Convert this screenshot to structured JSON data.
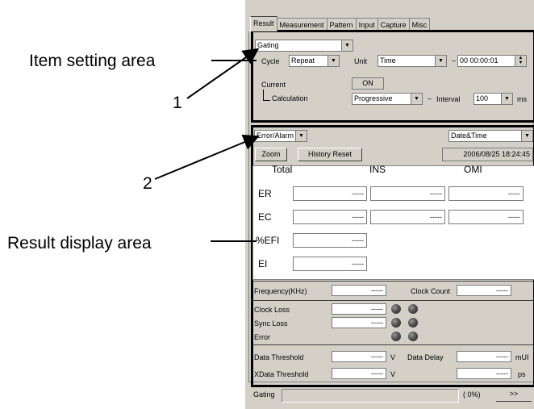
{
  "callouts": {
    "item_setting_area": "Item setting area",
    "result_display_area": "Result display area",
    "num_1": "1",
    "num_2": "2"
  },
  "tabs": [
    "Result",
    "Measurement",
    "Pattern",
    "Input",
    "Capture",
    "Misc"
  ],
  "item_setting": {
    "mode_select": "Gating",
    "cycle_label": "Cycle",
    "cycle_value": "Repeat",
    "unit_label": "Unit",
    "unit_value": "Time",
    "dash1": "–",
    "time_value": "00 00:00:01",
    "current_label": "Current",
    "current_value": "ON",
    "calculation_label": "Calculation",
    "calculation_value": "Progressive",
    "dash2": "–",
    "interval_label": "Interval",
    "interval_value": "100",
    "interval_unit": "ms"
  },
  "result_display": {
    "view_select": "Error/Alarm",
    "datetime_select": "Date&Time",
    "zoom_button": "Zoom",
    "history_reset_button": "History Reset",
    "datetime_value": "2006/08/25 18:24:45",
    "col_headers": [
      "Total",
      "INS",
      "OMI"
    ],
    "rows": [
      {
        "label": "ER",
        "values": [
          "-----",
          "-----",
          "-----"
        ]
      },
      {
        "label": "EC",
        "values": [
          "-----",
          "-----",
          "-----"
        ]
      },
      {
        "label": "%EFI",
        "values": [
          "-----"
        ]
      },
      {
        "label": "EI",
        "values": [
          "-----"
        ]
      }
    ],
    "frequency_label": "Frequency(KHz)",
    "frequency_value": "-----",
    "clock_count_label": "Clock Count",
    "clock_count_value": "-----",
    "clock_loss_label": "Clock Loss",
    "clock_loss_value": "-----",
    "sync_loss_label": "Sync Loss",
    "sync_loss_value": "-----",
    "error_label": "Error",
    "data_threshold_label": "Data Threshold",
    "data_threshold_value": "-----",
    "data_threshold_unit": "V",
    "data_delay_label": "Data Delay",
    "data_delay_value": "-----",
    "data_delay_unit": "mUI",
    "xdata_threshold_label": "XData Threshold",
    "xdata_threshold_value": "-----",
    "xdata_threshold_unit": "V",
    "xdata_delay_value": "-----",
    "xdata_delay_unit": "ps"
  },
  "status_bar": {
    "label": "Gating",
    "progress_text": "( 0%)",
    "progress_fraction": 0,
    "more_button": ">>"
  },
  "colors": {
    "panel_bg": "#d4d0c8",
    "highlight_frame": "#000000",
    "field_bg": "#ffffff"
  }
}
